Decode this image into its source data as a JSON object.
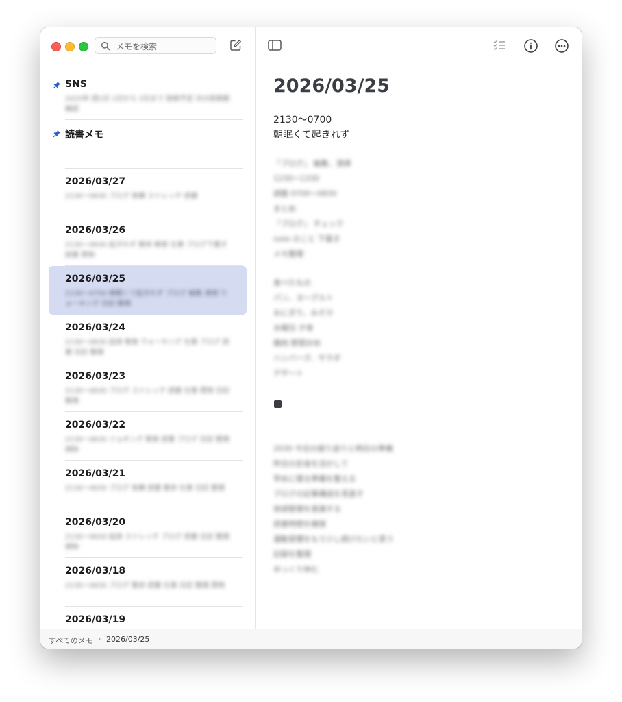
{
  "search": {
    "placeholder": "メモを検索"
  },
  "notes": [
    {
      "title": "SNS",
      "pinned": true,
      "preview": "2025年 週1日 1日から 2日まで 投稿予定 次の投稿案 確認",
      "selected": false
    },
    {
      "title": "読書メモ",
      "pinned": true,
      "preview": "",
      "selected": false
    },
    {
      "title": "2026/03/27",
      "pinned": false,
      "preview": "2130〜0630 ブログ 執筆 ストレッチ 読書",
      "selected": false
    },
    {
      "title": "2026/03/26",
      "pinned": false,
      "preview": "2130〜0630 起きれず 散歩 朝食 仕事 ブログ下書き 読書 買物",
      "selected": false
    },
    {
      "title": "2026/03/25",
      "pinned": false,
      "preview": "2130〜0700 朝眠くて起きれず ブログ 編集 清掃 ウォーキング 日記 整理",
      "selected": true
    },
    {
      "title": "2026/03/24",
      "pinned": false,
      "preview": "2130〜0630 起床 朝食 ウォーキング 仕事 ブログ 読書 日記 整理",
      "selected": false
    },
    {
      "title": "2026/03/23",
      "pinned": false,
      "preview": "2130〜0630 ブログ ストレッチ 読書 仕事 買物 日記 整理",
      "selected": false
    },
    {
      "title": "2026/03/22",
      "pinned": false,
      "preview": "2130〜0630 ジョギング 朝食 読書 ブログ 日記 整理 掃除",
      "selected": false
    },
    {
      "title": "2026/03/21",
      "pinned": false,
      "preview": "2130〜0630 ブログ 執筆 読書 散歩 仕事 日記 整理",
      "selected": false
    },
    {
      "title": "2026/03/20",
      "pinned": false,
      "preview": "2130〜0630 起床 ストレッチ ブログ 読書 日記 整理 掃除",
      "selected": false
    },
    {
      "title": "2026/03/18",
      "pinned": false,
      "preview": "2130〜0630 ブログ 散歩 読書 仕事 日記 整理 買物",
      "selected": false
    },
    {
      "title": "2026/03/19",
      "pinned": false,
      "preview": "",
      "selected": false
    }
  ],
  "editor": {
    "title": "2026/03/25",
    "line1": "2130〜0700",
    "line2": "朝眠くて起きれず",
    "block1": "「ブログ」 編集、清掃\n1230〜1330\n調整 0700〜0830\nまとめ\n「ブログ」 チェック\nnote のこと 下書き\nメモ整理",
    "block2": "食べたもの\nパン、ヨーグルト\nおにぎり、みそ汁\n水曜日 夕食\n鶏肉 野菜炒め\nハンバーグ、サラダ\nデザート",
    "block3": "2030 今日の振り返りと明日の準備\n昨日の反省を活かして\n早めに寝る準備を整える\nブログの記事構成を見直す\n体調管理を意識する\n読書時間を確保\n運動習慣をもう少し続けたいと思う\n記録を整理\nゆっくり休む"
  },
  "statusbar": {
    "crumb_root": "すべてのメモ",
    "crumb_current": "2026/03/25"
  }
}
